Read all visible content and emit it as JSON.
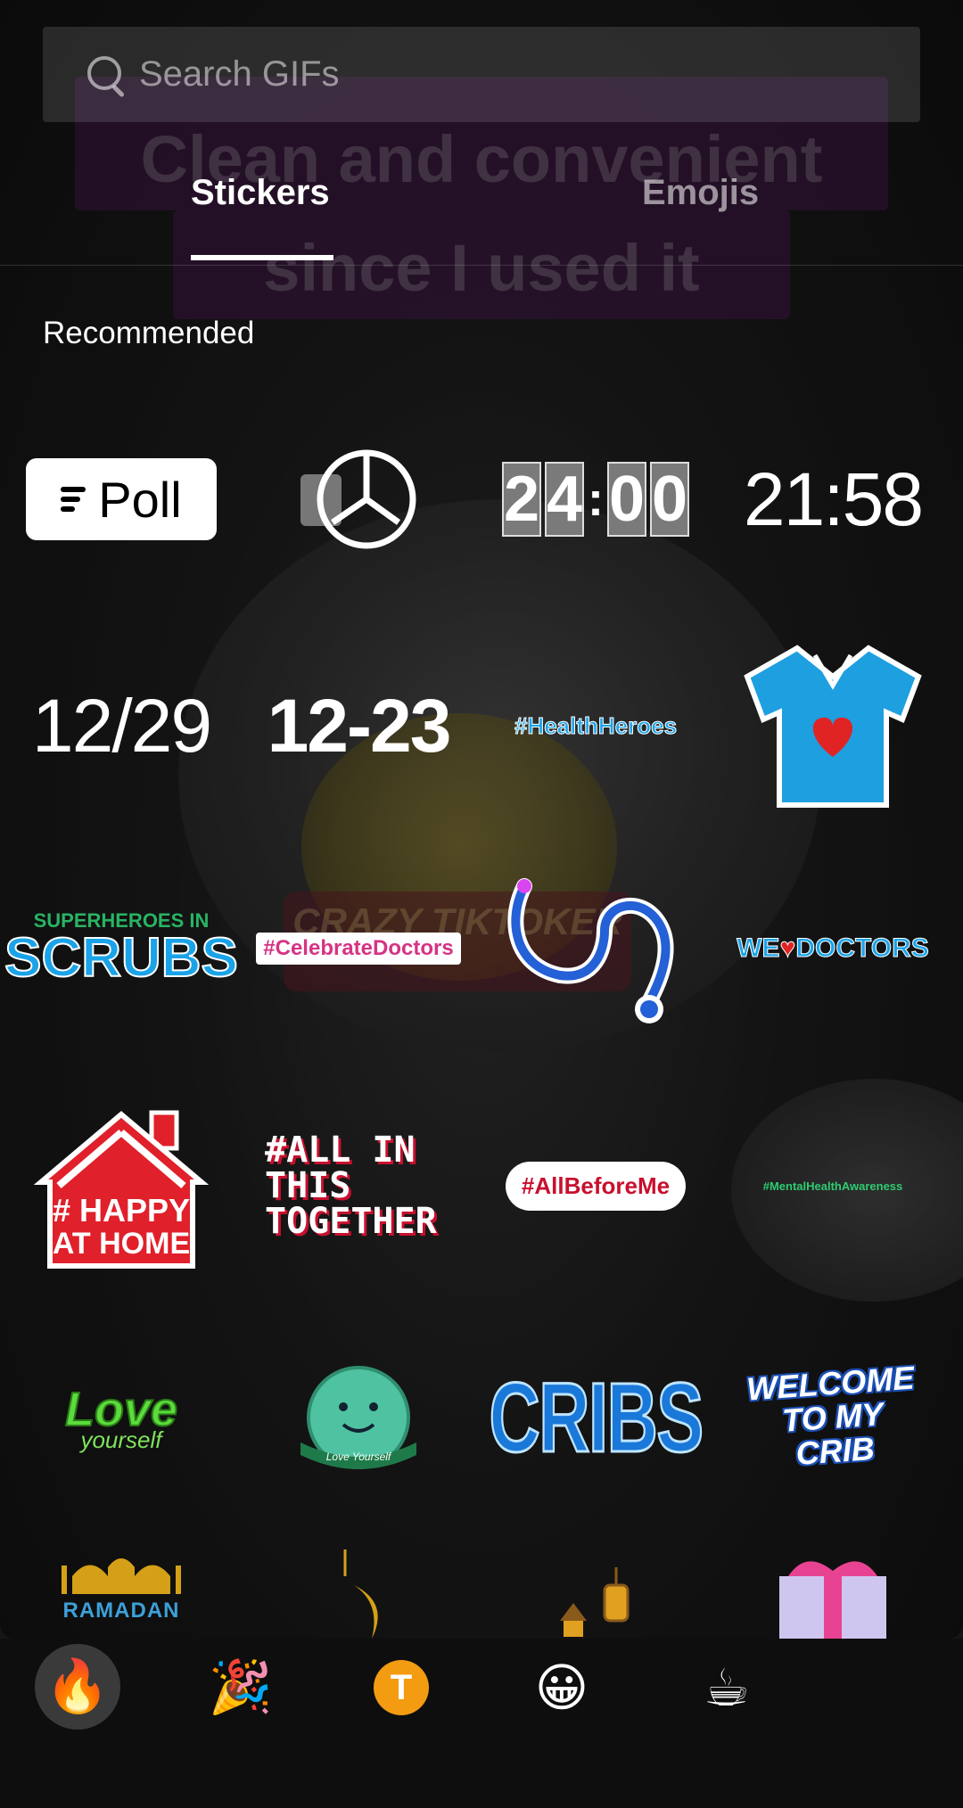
{
  "background": {
    "caption_line1": "Clean and convenient",
    "caption_line2": "since I used it",
    "watermark": "CRAZY TIKTOKER"
  },
  "search": {
    "placeholder": "Search GIFs"
  },
  "tabs": [
    {
      "label": "Stickers",
      "active": true
    },
    {
      "label": "Emojis",
      "active": false
    }
  ],
  "section": {
    "title": "Recommended"
  },
  "stickers": {
    "poll": "Poll",
    "flip_clock_h": [
      "2",
      "4"
    ],
    "flip_clock_m": [
      "0",
      "0"
    ],
    "time": "21:58",
    "date1": "12/29",
    "date2": "12-23",
    "health_heroes": "#HealthHeroes",
    "scrubs_top": "SUPERHEROES IN",
    "scrubs_bottom": "SCRUBS",
    "celebrate_doctors": "#CelebrateDoctors",
    "we_love_doctors_we": "WE",
    "we_love_doctors_doctors": "DOCTORS",
    "happy_home": "# HAPPY AT HOME",
    "all_together": "#ALL IN THIS TOGETHER",
    "all_before_me": "#AllBeforeMe",
    "mental_health": "#MentalHealthAwareness",
    "love_top": "Love",
    "love_bottom": "yourself",
    "mental_health_month": "Love Yourself",
    "cribs": "CRIBS",
    "welcome_crib": "WELCOME TO MY CRIB",
    "ramadan": "RAMADAN"
  },
  "bottom_bar": {
    "items": [
      {
        "icon": "fire-icon",
        "glyph": "🔥",
        "active": true
      },
      {
        "icon": "party-popper-icon",
        "glyph": "🎉",
        "active": false
      },
      {
        "icon": "text-t-icon",
        "glyph": "T",
        "active": false
      },
      {
        "icon": "grinning-face-icon",
        "glyph": "😀",
        "active": false
      },
      {
        "icon": "coffee-icon",
        "glyph": "☕",
        "active": false
      }
    ]
  },
  "colors": {
    "accent_orange": "#f39c12",
    "tab_underline": "#ffffff",
    "brand_red": "#c8102e",
    "brand_blue": "#1aa3e8"
  }
}
